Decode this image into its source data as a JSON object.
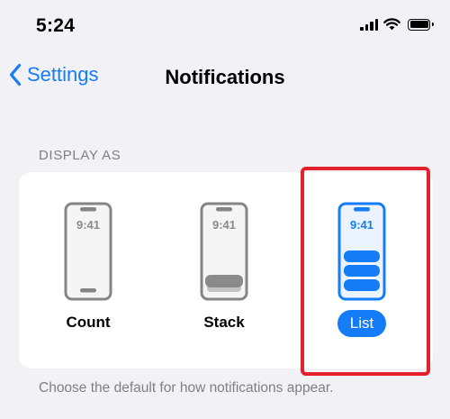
{
  "status_bar": {
    "time": "5:24",
    "signal_icon": "cellular-signal-icon",
    "wifi_icon": "wifi-icon",
    "battery_icon": "battery-icon"
  },
  "nav": {
    "back_label": "Settings",
    "back_icon": "chevron-left-icon",
    "title": "Notifications"
  },
  "display_as": {
    "header": "DISPLAY AS",
    "options": [
      {
        "label": "Count",
        "preview_time": "9:41",
        "selected": false
      },
      {
        "label": "Stack",
        "preview_time": "9:41",
        "selected": false
      },
      {
        "label": "List",
        "preview_time": "9:41",
        "selected": true
      }
    ],
    "footer": "Choose the default for how notifications appear."
  },
  "colors": {
    "accent": "#157cf7",
    "background": "#f2f1f6",
    "secondary_text": "#7f7f84",
    "highlight": "#e3202b"
  }
}
